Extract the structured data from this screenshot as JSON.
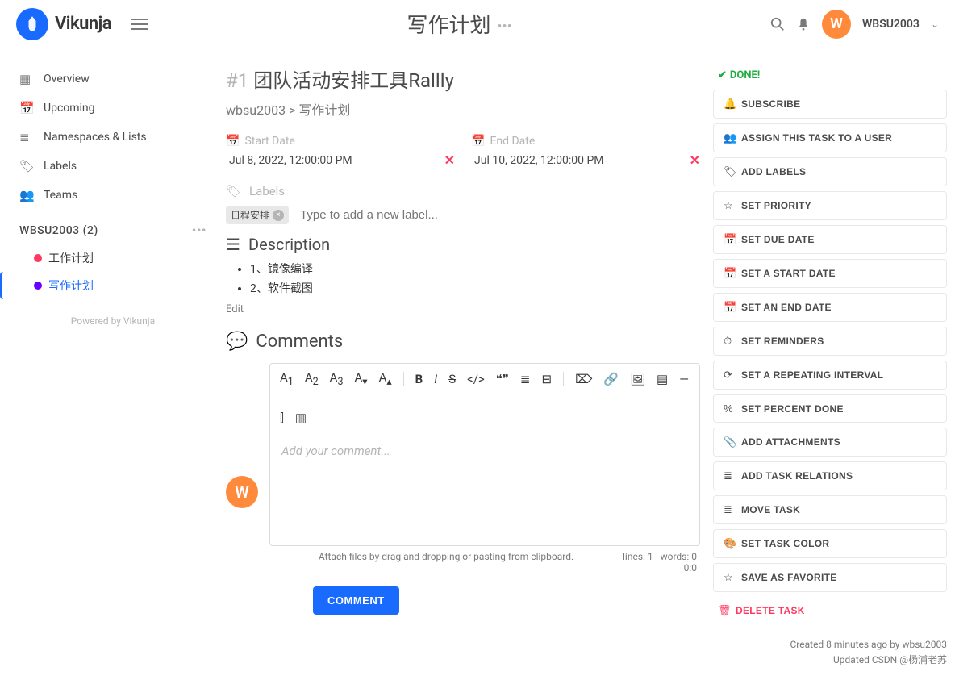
{
  "brand": "Vikunja",
  "header": {
    "title": "写作计划",
    "username": "WBSU2003",
    "avatar_letter": "W"
  },
  "sidebar": {
    "nav": [
      {
        "icon": "▦",
        "label": "Overview"
      },
      {
        "icon": "📅",
        "label": "Upcoming"
      },
      {
        "icon": "≣",
        "label": "Namespaces & Lists"
      },
      {
        "icon": "🏷",
        "label": "Labels"
      },
      {
        "icon": "👥",
        "label": "Teams"
      }
    ],
    "namespace": "WBSU2003 (2)",
    "lists": [
      {
        "color": "#ff3860",
        "label": "工作计划",
        "active": false
      },
      {
        "color": "#6a00ff",
        "label": "写作计划",
        "active": true
      }
    ],
    "powered": "Powered by Vikunja"
  },
  "task": {
    "number": "#1",
    "title": "团队活动安排工具Rallly",
    "breadcrumb": "wbsu2003 > 写作计划",
    "start_date_label": "Start Date",
    "start_date_value": "Jul 8, 2022, 12:00:00 PM",
    "end_date_label": "End Date",
    "end_date_value": "Jul 10, 2022, 12:00:00 PM",
    "labels_label": "Labels",
    "labels_chip": "日程安排",
    "labels_placeholder": "Type to add a new label...",
    "description_label": "Description",
    "description_items": [
      "1、镜像编译",
      "2、软件截图"
    ],
    "edit_label": "Edit",
    "comments_label": "Comments",
    "comment_placeholder": "Add your comment...",
    "attach_hint": "Attach files by drag and dropping or pasting from clipboard.",
    "lines_label": "lines: 1",
    "words_label": "words: 0",
    "time_label": "0:0",
    "comment_button": "COMMENT",
    "avatar_letter": "W"
  },
  "right": {
    "done": "DONE!",
    "actions": [
      {
        "icon": "🔔",
        "label": "SUBSCRIBE"
      },
      {
        "icon": "👥",
        "label": "ASSIGN THIS TASK TO A USER"
      },
      {
        "icon": "🏷",
        "label": "ADD LABELS"
      },
      {
        "icon": "☆",
        "label": "SET PRIORITY"
      },
      {
        "icon": "📅",
        "label": "SET DUE DATE"
      },
      {
        "icon": "📅",
        "label": "SET A START DATE"
      },
      {
        "icon": "📅",
        "label": "SET AN END DATE"
      },
      {
        "icon": "⏱",
        "label": "SET REMINDERS"
      },
      {
        "icon": "⟳",
        "label": "SET A REPEATING INTERVAL"
      },
      {
        "icon": "%",
        "label": "SET PERCENT DONE"
      },
      {
        "icon": "📎",
        "label": "ADD ATTACHMENTS"
      },
      {
        "icon": "≣",
        "label": "ADD TASK RELATIONS"
      },
      {
        "icon": "≣",
        "label": "MOVE TASK"
      },
      {
        "icon": "🎨",
        "label": "SET TASK COLOR"
      },
      {
        "icon": "☆",
        "label": "SAVE AS FAVORITE"
      }
    ],
    "delete": {
      "icon": "🗑",
      "label": "DELETE TASK"
    },
    "created": "Created 8 minutes ago by wbsu2003",
    "updated": "Updated CSDN @杨浦老苏"
  }
}
